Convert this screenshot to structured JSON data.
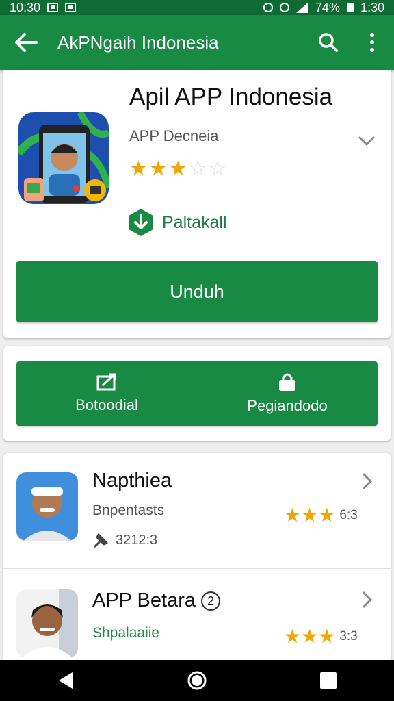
{
  "status_bar": {
    "time_left": "10:30",
    "battery_percent": "74%",
    "time_right": "1:30"
  },
  "toolbar": {
    "title": "AkPNgaih Indonesia",
    "icons": [
      "back-arrow-icon",
      "search-icon",
      "more-vert-icon"
    ]
  },
  "app": {
    "title": "Apil APP Indonesia",
    "subtitle": "APP Decneia",
    "rating_stars": 3,
    "rating_max": 5,
    "install_label": "Paltakall",
    "download_label": "Unduh"
  },
  "actions": [
    {
      "label": "Botoodial",
      "icon": "edit-icon"
    },
    {
      "label": "Pegiandodo",
      "icon": "lock-icon"
    }
  ],
  "list": [
    {
      "name": "Napthiea",
      "subtitle": "Bnpentasts",
      "meta": "3212:3",
      "score": "6:3",
      "stars": 3
    },
    {
      "name": "APP Betara",
      "badge": "2",
      "subtitle": "Shpalaaiie",
      "score": "3:3",
      "stars": 3
    }
  ],
  "colors": {
    "primary": "#198a43",
    "status_bar": "#0f6b33",
    "star": "#f2a600"
  }
}
